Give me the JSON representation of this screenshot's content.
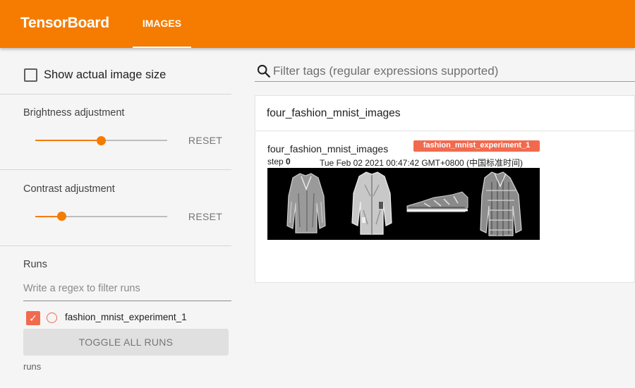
{
  "header": {
    "title": "TensorBoard",
    "tabs": [
      {
        "label": "IMAGES",
        "active": true
      }
    ]
  },
  "sidebar": {
    "show_actual_size": {
      "label": "Show actual image size",
      "checked": false
    },
    "brightness": {
      "title": "Brightness adjustment",
      "value_fraction": 0.5,
      "reset_label": "RESET"
    },
    "contrast": {
      "title": "Contrast adjustment",
      "value_fraction": 0.2,
      "reset_label": "RESET"
    },
    "runs": {
      "title": "Runs",
      "filter_placeholder": "Write a regex to filter runs",
      "items": [
        {
          "name": "fashion_mnist_experiment_1",
          "checked": true,
          "color": "#f26a4e"
        }
      ],
      "toggle_label": "TOGGLE ALL RUNS",
      "footer": "runs"
    }
  },
  "main": {
    "search_placeholder": "Filter tags (regular expressions supported)",
    "card": {
      "title": "four_fashion_mnist_images",
      "image": {
        "tag": "four_fashion_mnist_images",
        "run": "fashion_mnist_experiment_1",
        "step_label": "step",
        "step": "0",
        "timestamp": "Tue Feb 02 2021 00:47:42 GMT+0800 (中国标准时间)",
        "items": [
          "pullover",
          "shirt",
          "sneaker",
          "shirt"
        ]
      }
    }
  },
  "colors": {
    "accent": "#f57c00",
    "run": "#f26a4e"
  },
  "icons": {
    "search": "search-icon",
    "check": "check-icon"
  }
}
